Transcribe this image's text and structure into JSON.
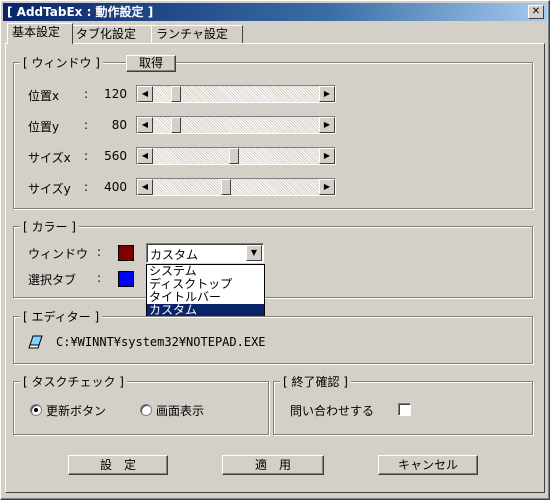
{
  "window": {
    "title": "[ AddTabEx : 動作設定 ]",
    "close_glyph": "✕"
  },
  "tabs": [
    {
      "label": "基本設定"
    },
    {
      "label": "タブ化設定"
    },
    {
      "label": "ランチャ設定"
    }
  ],
  "window_group": {
    "title": "[ ウィンドウ ]",
    "get_button": "取得",
    "rows": [
      {
        "label": "位置x",
        "colon": ":",
        "value": "120"
      },
      {
        "label": "位置y",
        "colon": ":",
        "value": "80"
      },
      {
        "label": "サイズx",
        "colon": ":",
        "value": "560"
      },
      {
        "label": "サイズy",
        "colon": ":",
        "value": "400"
      }
    ]
  },
  "color_group": {
    "title": "[ カラー ]",
    "window_label": "ウィンドウ",
    "window_colon": ":",
    "window_color": "#800000",
    "tab_label": "選択タブ",
    "tab_colon": ":",
    "tab_color": "#0000ff",
    "combo_value": "カスタム",
    "options": [
      "システム",
      "ディスクトップ",
      "タイトルバー",
      "カスタム"
    ],
    "selected_option": "カスタム"
  },
  "editor_group": {
    "title": "[ エディター ]",
    "icon": "pencil-eraser-icon",
    "path": "C:¥WINNT¥system32¥NOTEPAD.EXE"
  },
  "taskcheck_group": {
    "title": "[ タスクチェック ]",
    "options": [
      {
        "label": "更新ボタン",
        "checked": true
      },
      {
        "label": "画面表示",
        "checked": false
      }
    ]
  },
  "exit_group": {
    "title": "[ 終了確認 ]",
    "checkbox_label": "問い合わせする",
    "checked": false
  },
  "buttons": {
    "settings": "設　定",
    "apply": "適　用",
    "cancel": "キャンセル"
  }
}
